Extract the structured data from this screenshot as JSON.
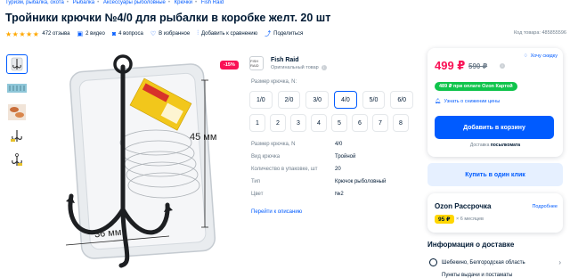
{
  "breadcrumbs": [
    "Туризм, рыбалка, охота",
    "Рыбалка",
    "Аксессуары рыболовные",
    "Крючки",
    "Fish Raid"
  ],
  "title": "Тройники крючки №4/0 для рыбалки в коробке желт. 20 шт",
  "meta": {
    "stars": "★★★★★",
    "reviews": "472 отзыва",
    "video": "2 видео",
    "questions": "4 вопроса",
    "favorite": "В избранное",
    "compare": "Добавить к сравнению",
    "share": "Поделиться"
  },
  "product_code": "Код товара: 485855596",
  "discount_badge": "-15%",
  "photo_labels": {
    "height": "45 мм",
    "width": "36 мм"
  },
  "brand": {
    "logo_text": "FISH RAID",
    "name": "Fish Raid",
    "subtitle": "Оригинальный товар"
  },
  "size_label": "Размер крючка, N:",
  "sizes_row1": [
    "1/0",
    "2/0",
    "3/0",
    "4/0",
    "5/0",
    "6/0"
  ],
  "sizes_row2": [
    "1",
    "2",
    "3",
    "4",
    "5",
    "6",
    "7",
    "8"
  ],
  "selected_size": "4/0",
  "specs": [
    {
      "k": "Размер крючка, N",
      "v": "4/0"
    },
    {
      "k": "Вид крючка",
      "v": "Тройной"
    },
    {
      "k": "Количество в упаковке, шт",
      "v": "20"
    },
    {
      "k": "Тип",
      "v": "Крючок рыболовный"
    },
    {
      "k": "Цвет",
      "v": "№2"
    }
  ],
  "more_link": "Перейти к описанию",
  "buy_card": {
    "price": "499 ₽",
    "old_price": "590 ₽",
    "want_cheaper": "Хочу скидку",
    "ozon_card_price": "489 ₽ при оплате Ozon Картой",
    "notify": "Узнать о снижении цены",
    "cart_button": "Добавить в корзину",
    "courier_prefix": "Доставка",
    "courier_name": "посылкомата"
  },
  "one_click": "Купить в один клик",
  "installment": {
    "title": "Ozon Рассрочка",
    "more": "Подробнее",
    "price": "95 ₽",
    "months": "× 6 месяцев"
  },
  "delivery": {
    "title": "Информация о доставке",
    "location": "Шебекино, Белгородская область",
    "next": "Пункты выдачи и постаматы"
  },
  "colors": {
    "accent": "#005bff",
    "price": "#f91155",
    "green": "#10c44c",
    "yellow": "#ffd600"
  }
}
